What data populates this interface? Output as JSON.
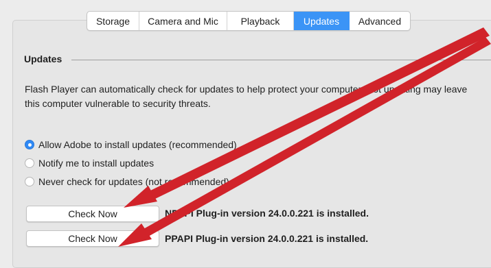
{
  "tabs": [
    {
      "label": "Storage",
      "active": false
    },
    {
      "label": "Camera and Mic",
      "active": false
    },
    {
      "label": "Playback",
      "active": false
    },
    {
      "label": "Updates",
      "active": true
    },
    {
      "label": "Advanced",
      "active": false
    }
  ],
  "section": {
    "title": "Updates",
    "description": "Flash Player can automatically check for updates to help protect your computer. Not updating may leave this computer vulnerable to security threats."
  },
  "update_options": [
    {
      "label": "Allow Adobe to install updates (recommended)",
      "selected": true
    },
    {
      "label": "Notify me to install updates",
      "selected": false
    },
    {
      "label": "Never check for updates (not recommended)",
      "selected": false
    }
  ],
  "plugins": [
    {
      "button_label": "Check Now",
      "status": "NPAPI Plug-in version 24.0.0.221 is installed."
    },
    {
      "button_label": "Check Now",
      "status": "PPAPI Plug-in version 24.0.0.221 is installed."
    }
  ],
  "colors": {
    "accent": "#3b94f6",
    "annotation_arrow": "#d1232a"
  },
  "icons": {
    "annotation": "arrow-icon"
  }
}
